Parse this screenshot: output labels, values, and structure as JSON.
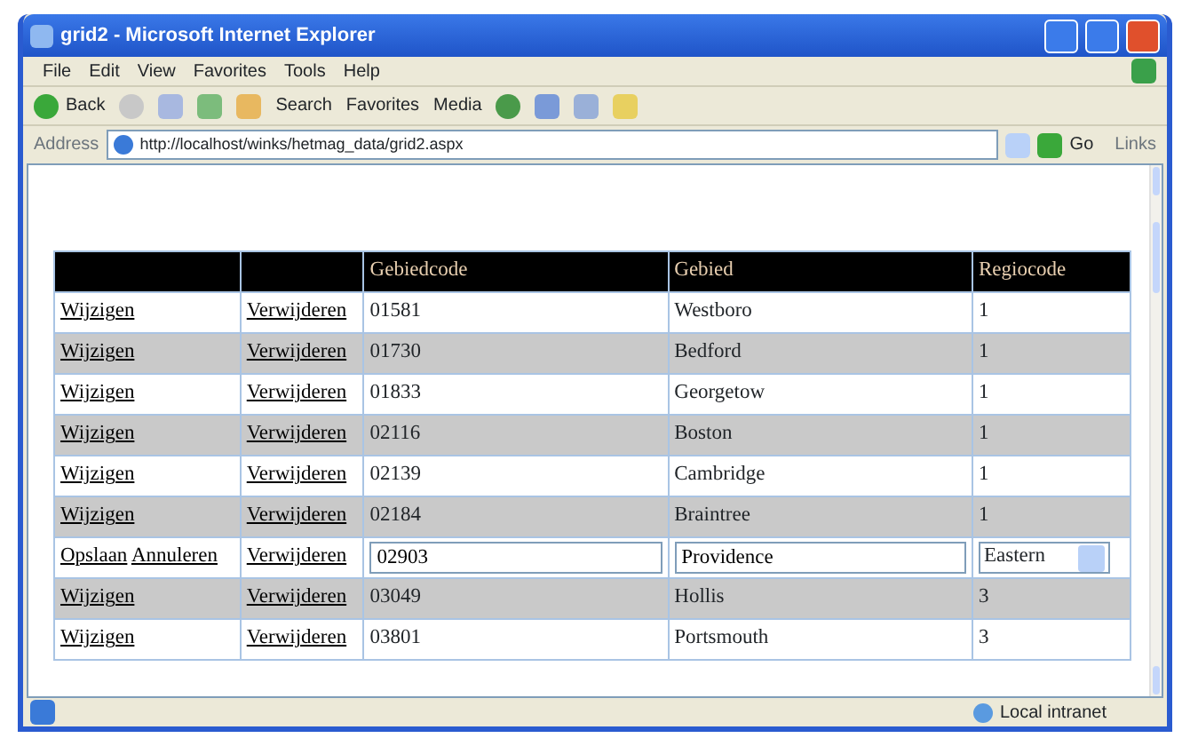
{
  "window": {
    "title": "grid2 - Microsoft Internet Explorer"
  },
  "menu": [
    "File",
    "Edit",
    "View",
    "Favorites",
    "Tools",
    "Help"
  ],
  "toolbar": {
    "back": "Back",
    "search": "Search",
    "favorites": "Favorites",
    "media": "Media"
  },
  "address_bar": {
    "label": "Address",
    "url": "http://localhost/winks/hetmag_data/grid2.aspx",
    "go": "Go",
    "links": "Links"
  },
  "table": {
    "columns": [
      "Gebiedcode",
      "Gebied",
      "Regiocode"
    ],
    "rows": [
      {
        "kind": "view",
        "actions": [
          "Wijzigen"
        ],
        "delete": "Verwijderen",
        "code": "01581",
        "area": "Westboro",
        "region": "1"
      },
      {
        "kind": "view",
        "actions": [
          "Wijzigen"
        ],
        "delete": "Verwijderen",
        "code": "01730",
        "area": "Bedford",
        "region": "1"
      },
      {
        "kind": "view",
        "actions": [
          "Wijzigen"
        ],
        "delete": "Verwijderen",
        "code": "01833",
        "area": "Georgetow",
        "region": "1"
      },
      {
        "kind": "view",
        "actions": [
          "Wijzigen"
        ],
        "delete": "Verwijderen",
        "code": "02116",
        "area": "Boston",
        "region": "1"
      },
      {
        "kind": "view",
        "actions": [
          "Wijzigen"
        ],
        "delete": "Verwijderen",
        "code": "02139",
        "area": "Cambridge",
        "region": "1"
      },
      {
        "kind": "view",
        "actions": [
          "Wijzigen"
        ],
        "delete": "Verwijderen",
        "code": "02184",
        "area": "Braintree",
        "region": "1"
      },
      {
        "kind": "edit",
        "actions": [
          "Opslaan",
          "Annuleren"
        ],
        "delete": "Verwijderen",
        "code": "02903",
        "area": "Providence",
        "region": "Eastern"
      },
      {
        "kind": "view",
        "actions": [
          "Wijzigen"
        ],
        "delete": "Verwijderen",
        "code": "03049",
        "area": "Hollis",
        "region": "3"
      },
      {
        "kind": "view",
        "actions": [
          "Wijzigen"
        ],
        "delete": "Verwijderen",
        "code": "03801",
        "area": "Portsmouth",
        "region": "3"
      }
    ]
  },
  "status_bar": {
    "zone": "Local intranet"
  }
}
